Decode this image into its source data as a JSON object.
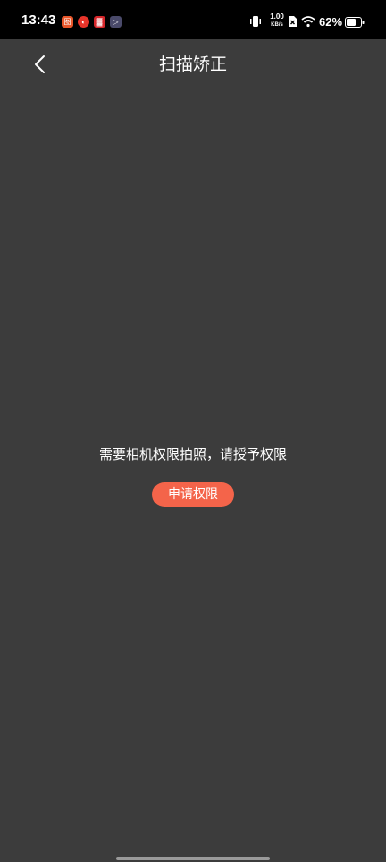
{
  "status_bar": {
    "time": "13:43",
    "notification_icons": [
      {
        "name": "app-icon-1",
        "glyph": "图",
        "color": "#e8562a"
      },
      {
        "name": "app-icon-2",
        "glyph": "◐",
        "color": "#e8342a"
      },
      {
        "name": "app-icon-3",
        "glyph": "▓",
        "color": "#d6262a"
      },
      {
        "name": "app-icon-4",
        "glyph": "▷",
        "color": "#4a4a6a"
      }
    ],
    "net_speed_value": "1.00",
    "net_speed_unit": "KB/s",
    "battery_percent": "62%"
  },
  "header": {
    "title": "扫描矫正"
  },
  "main": {
    "permission_message": "需要相机权限拍照，请授予权限",
    "request_button_label": "申请权限"
  },
  "colors": {
    "background": "#3c3c3c",
    "accent": "#f4644a",
    "status_bar": "#000000"
  }
}
